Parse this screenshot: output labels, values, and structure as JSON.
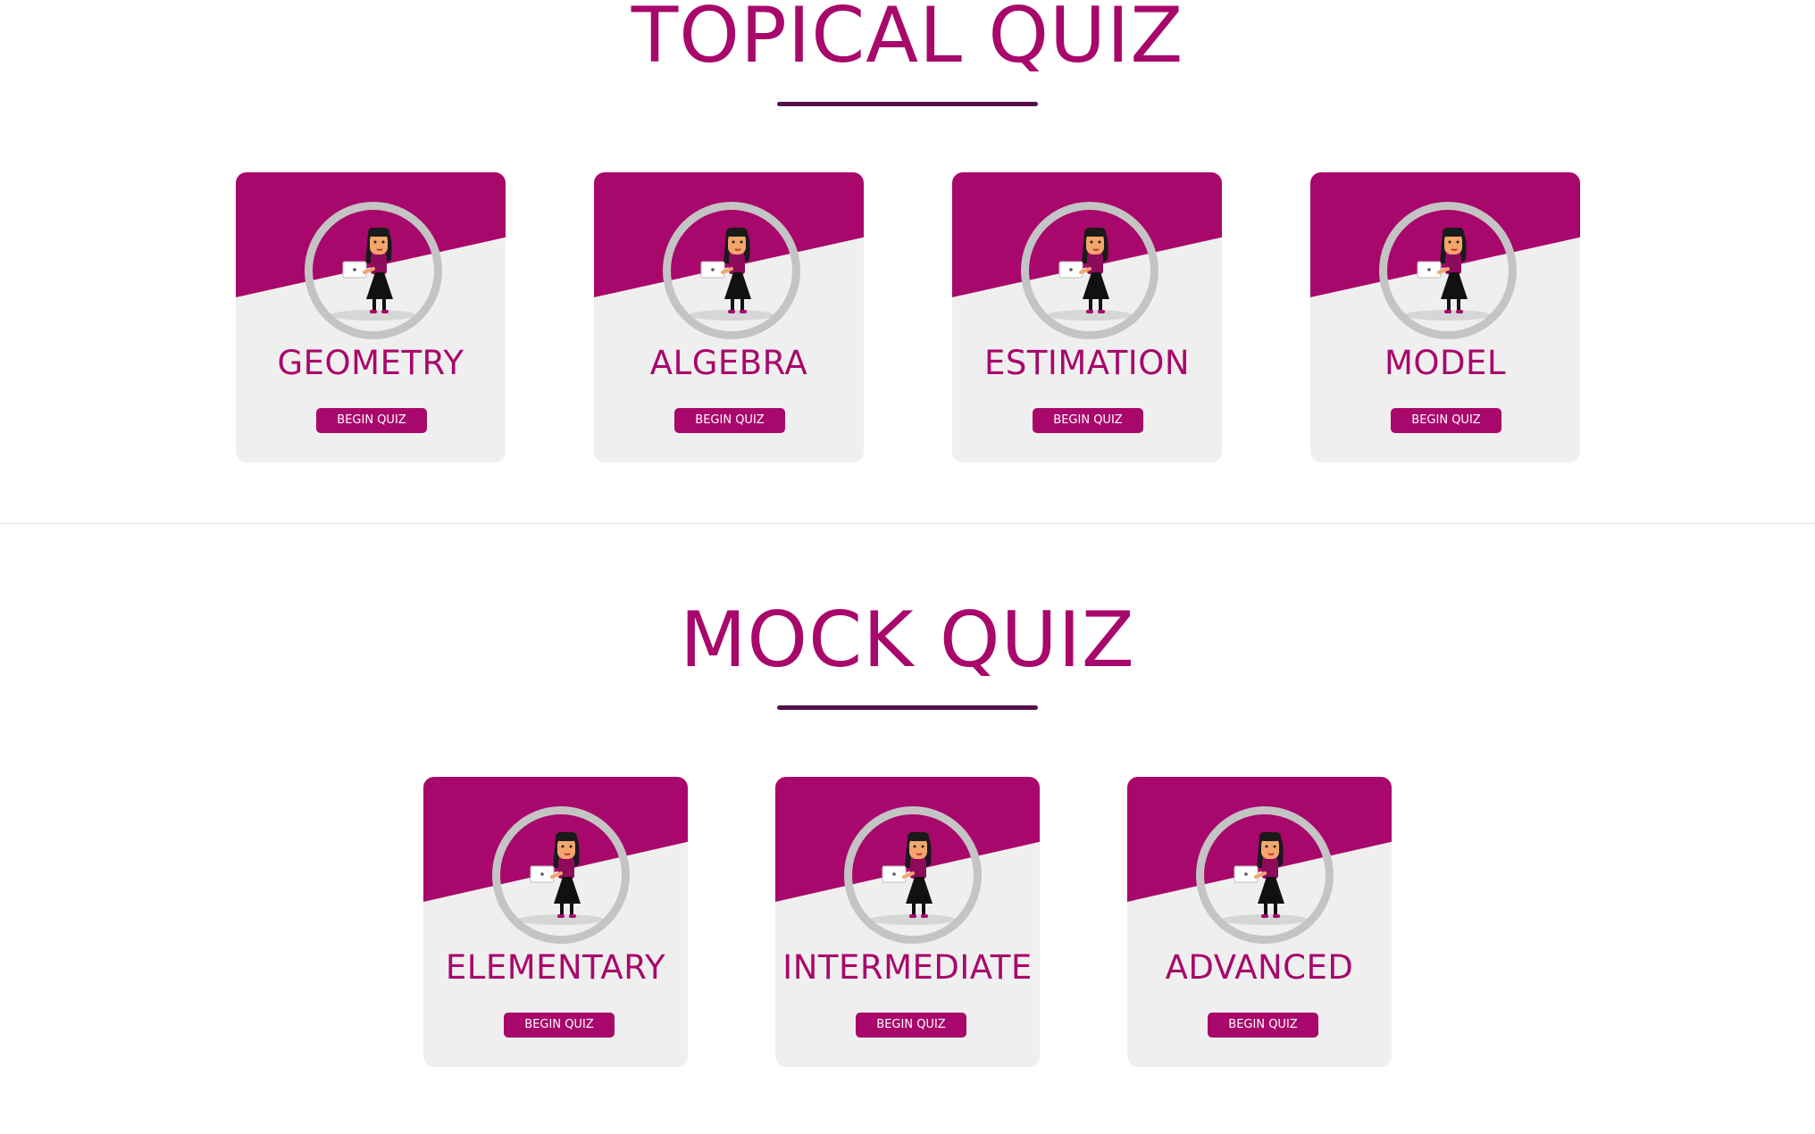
{
  "colors": {
    "brand": "#a8086b",
    "underline": "#55104a",
    "card_background": "#efefef",
    "ring": "#c4c4c4",
    "button_text": "#ffffff"
  },
  "topical": {
    "title": "TOPICAL QUIZ",
    "cards": [
      {
        "label": "GEOMETRY",
        "button": "BEGIN QUIZ",
        "icon": "girl-with-laptop-avatar"
      },
      {
        "label": "ALGEBRA",
        "button": "BEGIN QUIZ",
        "icon": "girl-with-laptop-avatar"
      },
      {
        "label": "ESTIMATION",
        "button": "BEGIN QUIZ",
        "icon": "girl-with-laptop-avatar"
      },
      {
        "label": "MODEL",
        "button": "BEGIN QUIZ",
        "icon": "girl-with-laptop-avatar"
      }
    ]
  },
  "mock": {
    "title": "MOCK QUIZ",
    "cards": [
      {
        "label": "ELEMENTARY",
        "button": "BEGIN QUIZ",
        "icon": "girl-with-laptop-avatar"
      },
      {
        "label": "INTERMEDIATE",
        "button": "BEGIN QUIZ",
        "icon": "girl-with-laptop-avatar"
      },
      {
        "label": "ADVANCED",
        "button": "BEGIN QUIZ",
        "icon": "girl-with-laptop-avatar"
      }
    ]
  }
}
